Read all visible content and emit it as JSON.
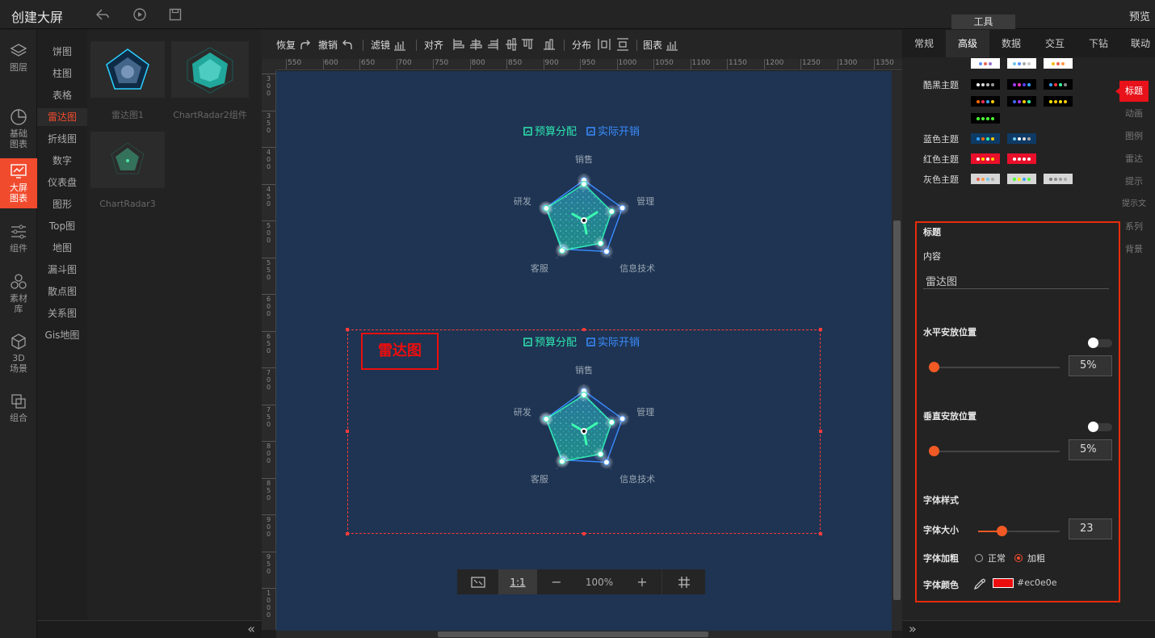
{
  "app": {
    "title": "创建大屏",
    "preview": "预览",
    "tools_tab": "工具"
  },
  "leftnav": [
    {
      "label": "图层",
      "icon": "layers-icon"
    },
    {
      "label": "基础图表",
      "icon": "pie-chart-icon"
    },
    {
      "label": "大屏图表",
      "icon": "screen-chart-icon"
    },
    {
      "label": "组件",
      "icon": "sliders-icon"
    },
    {
      "label": "素材库",
      "icon": "hexagons-icon"
    },
    {
      "label": "3D场景",
      "icon": "cube-icon"
    },
    {
      "label": "组合",
      "icon": "combine-icon"
    }
  ],
  "categories": [
    "饼图",
    "柱图",
    "表格",
    "雷达图",
    "折线图",
    "数字",
    "仪表盘",
    "图形",
    "Top图",
    "地图",
    "漏斗图",
    "散点图",
    "关系图",
    "Gis地图"
  ],
  "thumbs": [
    "雷达图1",
    "ChartRadar2组件",
    "ChartRadar3"
  ],
  "toolbar": {
    "redo": "恢复",
    "undo": "撤销",
    "filter": "滤镜",
    "align": "对齐",
    "distribute": "分布",
    "chart": "图表"
  },
  "ruler": {
    "h": [
      "550",
      "600",
      "650",
      "700",
      "750",
      "800",
      "850",
      "900",
      "950",
      "1000",
      "1050",
      "1100",
      "1150",
      "1200",
      "1250",
      "1300",
      "1350"
    ],
    "v": [
      "300",
      "350",
      "400",
      "450",
      "500",
      "550",
      "600",
      "650",
      "700",
      "750",
      "800",
      "850",
      "900",
      "950",
      "1000"
    ]
  },
  "chart_data": [
    {
      "type": "radar",
      "legend": [
        "预算分配",
        "实际开销"
      ],
      "indicators": [
        "销售",
        "管理",
        "信息技术",
        "客服",
        "研发"
      ],
      "series": [
        {
          "name": "预算分配",
          "color": "#2ee6b1"
        },
        {
          "name": "实际开销",
          "color": "#3b8cff"
        }
      ]
    },
    {
      "type": "radar",
      "title": "雷达图",
      "legend": [
        "预算分配",
        "实际开销"
      ],
      "indicators": [
        "销售",
        "管理",
        "信息技术",
        "客服",
        "研发"
      ],
      "series": [
        {
          "name": "预算分配",
          "color": "#2ee6b1"
        },
        {
          "name": "实际开销",
          "color": "#3b8cff"
        }
      ]
    }
  ],
  "zoom": {
    "ratio": "1:1",
    "level": "100%",
    "minus": "−",
    "plus": "+"
  },
  "rtabs": [
    "常规",
    "高级",
    "数据",
    "交互",
    "下钻",
    "联动"
  ],
  "themes": [
    {
      "label": "酷黑主题",
      "colors": [
        "#000"
      ]
    },
    {
      "label": "蓝色主题",
      "colors": [
        "#0e3a66"
      ]
    },
    {
      "label": "红色主题",
      "colors": [
        "#e8102a"
      ]
    },
    {
      "label": "灰色主题",
      "colors": [
        "#d6d6d6"
      ]
    }
  ],
  "sidetabs": [
    "标题",
    "动画",
    "图例",
    "雷达",
    "提示",
    "提示文",
    "系列",
    "背景"
  ],
  "props": {
    "section": "标题",
    "content_label": "内容",
    "content_value": "雷达图",
    "hpos_label": "水平安放位置",
    "hpos_value": "5%",
    "vpos_label": "垂直安放位置",
    "vpos_value": "5%",
    "font_section": "字体样式",
    "size_label": "字体大小",
    "size_value": "23",
    "bold_label": "字体加粗",
    "bold_normal": "正常",
    "bold_bold": "加粗",
    "color_label": "字体颜色",
    "color_value": "#ec0e0e"
  },
  "colors": {
    "accent": "#f14b2d",
    "canvas": "#1e3452",
    "title_red": "#ec0e0e"
  }
}
